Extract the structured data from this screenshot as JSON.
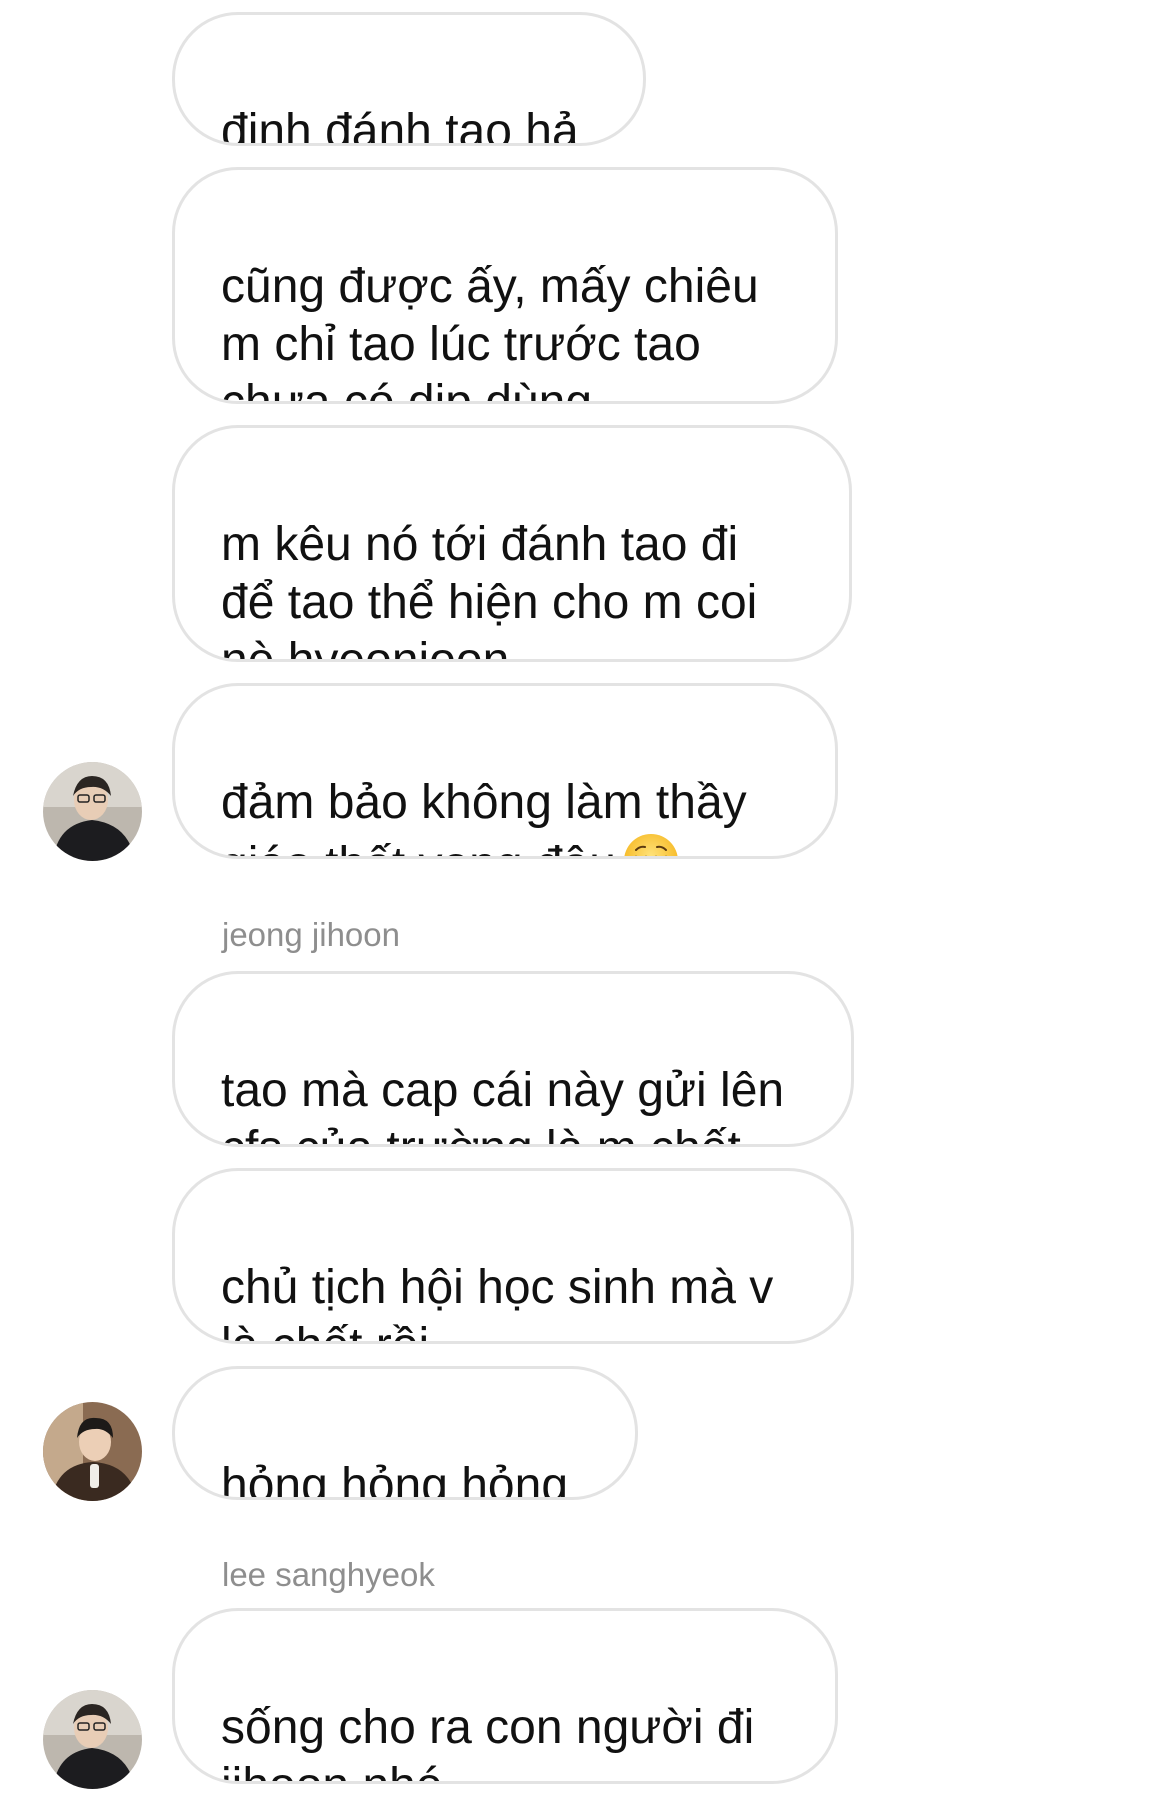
{
  "messages": [
    {
      "text": "định đánh tao hả"
    },
    {
      "text": "cũng được ấy, mấy chiêu\nm chỉ tao lúc trước tao\nchưa có dịp dùng"
    },
    {
      "text": "m kêu nó tới đánh tao đi\nđể tao thể hiện cho m coi\nnè hyeonjoon"
    },
    {
      "text": "đảm bảo không làm thầy\ngiáo thất vọng đâu",
      "emoji": "relieved-face-icon"
    },
    {
      "sender": "jeong jihoon"
    },
    {
      "text": "tao mà cap cái này gửi lên\ncfs của trường là m chết"
    },
    {
      "text": "chủ tịch hội học sinh mà v\nlà chết rồi"
    },
    {
      "text": "hỏng hỏng hỏng"
    },
    {
      "sender": "lee sanghyeok"
    },
    {
      "text": "sống cho ra con người đi\njihoon nhé"
    }
  ],
  "colors": {
    "bubble_border": "#e3e3e3",
    "sender_name": "#8e8e8e",
    "text": "#111111"
  }
}
